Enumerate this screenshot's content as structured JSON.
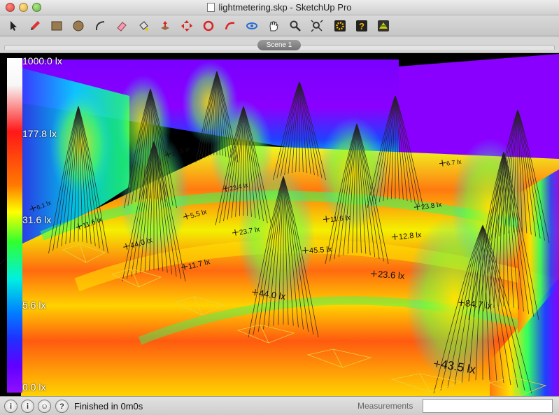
{
  "window": {
    "title": "lightmetering.skp - SketchUp Pro"
  },
  "toolbar": {
    "tools": [
      {
        "name": "select-tool",
        "icon": "arrow-icon"
      },
      {
        "name": "pencil-tool",
        "icon": "pencil-icon"
      },
      {
        "name": "rectangle-tool",
        "icon": "rectangle-icon"
      },
      {
        "name": "circle-tool",
        "icon": "circle-icon"
      },
      {
        "name": "arc-tool",
        "icon": "arc-icon"
      },
      {
        "name": "eraser-tool",
        "icon": "eraser-icon"
      },
      {
        "name": "paint-bucket-tool",
        "icon": "paint-bucket-icon"
      },
      {
        "name": "push-pull-tool",
        "icon": "push-pull-icon"
      },
      {
        "name": "move-tool",
        "icon": "move-icon"
      },
      {
        "name": "rotate-tool",
        "icon": "rotate-icon"
      },
      {
        "name": "follow-me-tool",
        "icon": "follow-me-icon"
      },
      {
        "name": "orbit-tool",
        "icon": "orbit-icon"
      },
      {
        "name": "pan-tool",
        "icon": "hand-icon"
      },
      {
        "name": "zoom-tool",
        "icon": "magnifier-icon"
      },
      {
        "name": "zoom-extents-tool",
        "icon": "zoom-extents-icon"
      },
      {
        "name": "plugin-settings-tool",
        "icon": "gear-icon"
      },
      {
        "name": "help-tool",
        "icon": "question-icon"
      },
      {
        "name": "extension-tool",
        "icon": "extension-icon"
      }
    ]
  },
  "scenes": {
    "active": "Scene 1"
  },
  "legend": {
    "labels": [
      "1000.0 lx",
      "177.8 lx",
      "31.6 lx",
      "5.6 lx",
      "0.0 lx"
    ]
  },
  "lux_labels": [
    "6.1 lx",
    "10.5 lx",
    "23.4 lx",
    "6.7 lx",
    "23.8 lx",
    "12.8 lx",
    "11.6 lx",
    "44.0 lx",
    "5.5 lx",
    "11.7 lx",
    "23.7 lx",
    "45.5 lx",
    "11.6 lx",
    "44.0 lx",
    "23.6 lx",
    "84.7 lx",
    "43.5 lx"
  ],
  "statusbar": {
    "status": "Finished in 0m0s",
    "measurements_label": "Measurements",
    "measurements_value": ""
  },
  "colors": {
    "floor_warm": "#ff7a10",
    "floor_yellow": "#f4f000",
    "wall_purple": "#8a00ff",
    "wall_blue": "#2030ff",
    "cone_lines": "#222222",
    "fixture_outline": "#e8d43a"
  }
}
